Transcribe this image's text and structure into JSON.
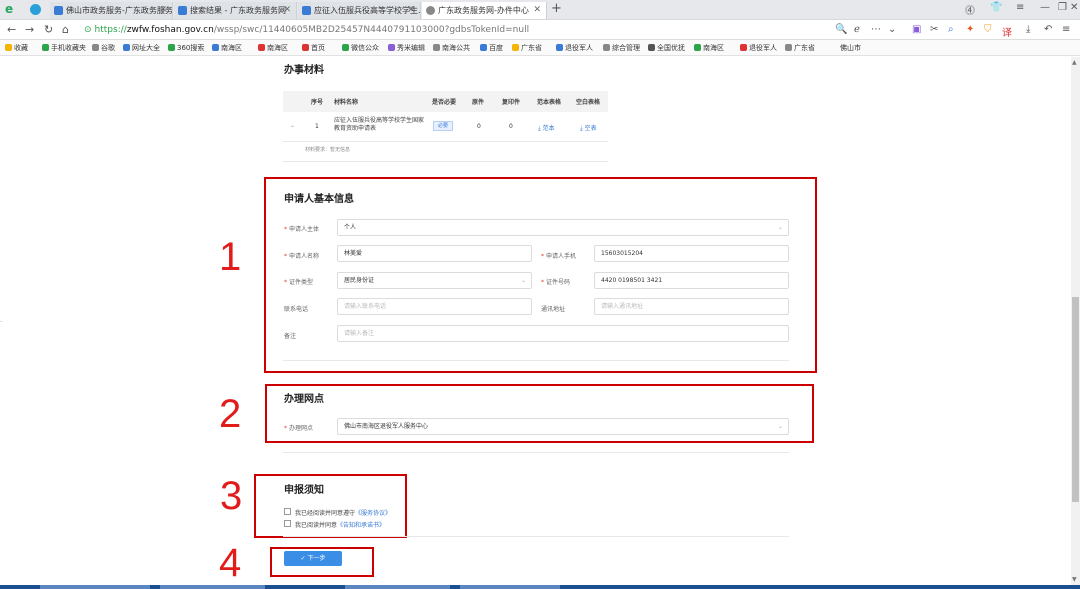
{
  "browser": {
    "tabs": [
      {
        "label": "佛山市政务服务-广东政务服务网"
      },
      {
        "label": "搜索结果 - 广东政务服务网"
      },
      {
        "label": "应征入伍服兵役高等学校学生..."
      },
      {
        "label": "广东政务服务网-办件中心"
      }
    ],
    "url_prefix": "https://",
    "url_domain": "zwfw.foshan.gov.cn",
    "url_path": "/wssp/swc/11440605MB2D25457N4440791103000?gdbsTokenId=null",
    "bookmarks": [
      "收藏",
      "手机收藏夹",
      "谷歌",
      "网址大全",
      "360搜索",
      "南海区",
      "南海区",
      "首页",
      "微信公众",
      "秀米编辑",
      "南海公共",
      "百度",
      "广东省",
      "退役军人",
      "综合管理",
      "全国优抚",
      "南海区",
      "退役军人",
      "广东省",
      "佛山市"
    ]
  },
  "materials": {
    "title": "办事材料",
    "headers": [
      "序号",
      "材料名称",
      "是否必要",
      "原件",
      "复印件",
      "范本表格",
      "空白表格"
    ],
    "row": {
      "index": "1",
      "name": "应征入伍服兵役高等学校学生国家教育资助申请表",
      "required": "必要",
      "original": "0",
      "copy": "0",
      "sample": "范本",
      "blank": "空表"
    },
    "note": "材料要求：暂无信息"
  },
  "applicant": {
    "title": "申请人基本信息",
    "subject_label": "申请人主体",
    "subject_value": "个人",
    "name_label": "申请人名称",
    "name_value": "林美爱",
    "phone_label": "申请人手机",
    "phone_value": "15603015204",
    "id_type_label": "证件类型",
    "id_type_value": "居民身份证",
    "id_no_label": "证件号码",
    "id_no_value": "4420 0198501 3421",
    "contact_label": "联系电话",
    "contact_placeholder": "请输入联系电话",
    "address_label": "通讯地址",
    "address_placeholder": "请输入通讯地址",
    "remark_label": "备注",
    "remark_placeholder": "请输入备注"
  },
  "office": {
    "title": "办理网点",
    "label": "办理网点",
    "value": "佛山市南海区退役军人服务中心"
  },
  "notice": {
    "title": "申报须知",
    "item1_text": "我已经阅读并同意遵守",
    "item1_link": "《服务协议》",
    "item2_text": "我已阅读并同意",
    "item2_link": "《告知和承诺书》"
  },
  "next_button": "✓ 下一步",
  "annotations": [
    "1",
    "2",
    "3",
    "4"
  ],
  "colors": {
    "accent": "#3a8ee6",
    "annotation_red": "#cc0000"
  }
}
